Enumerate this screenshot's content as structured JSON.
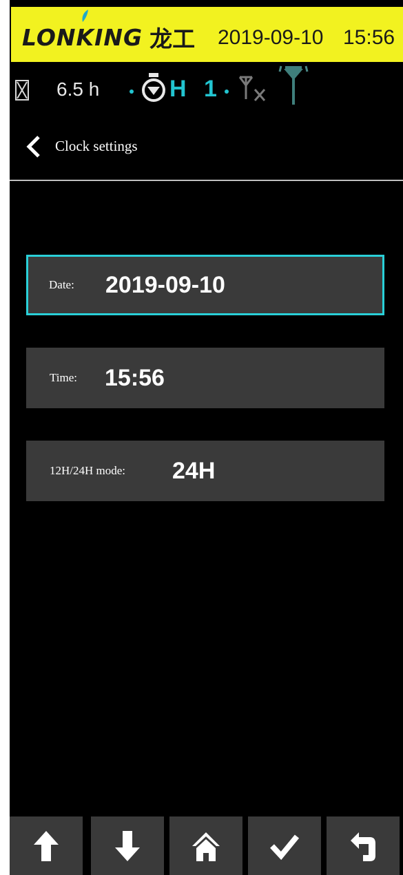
{
  "topbar": {
    "brand": "LONKING",
    "brand_cn": "龙工",
    "date": "2019-09-10",
    "time": "15:56",
    "background": "#f2f220"
  },
  "status": {
    "hours": "6.5 h",
    "gear_mode": "H",
    "gear_number": "1",
    "icons": [
      "hourglass-icon",
      "engine-icon",
      "no-signal-antenna-icon",
      "signal-tower-icon"
    ],
    "accent": "#22c4d0"
  },
  "header": {
    "back_icon": "chevron-left-icon",
    "title": "Clock settings"
  },
  "settings": [
    {
      "label": "Date:",
      "value": "2019-09-10",
      "selected": true
    },
    {
      "label": "Time:",
      "value": "15:56",
      "selected": false
    },
    {
      "label": "12H/24H mode:",
      "value": "24H",
      "selected": false
    }
  ],
  "nav_buttons": [
    {
      "name": "up",
      "icon": "arrow-up-icon"
    },
    {
      "name": "down",
      "icon": "arrow-down-icon"
    },
    {
      "name": "home",
      "icon": "home-icon"
    },
    {
      "name": "confirm",
      "icon": "check-icon"
    },
    {
      "name": "back",
      "icon": "return-icon"
    }
  ],
  "colors": {
    "background": "#000000",
    "row": "#3a3a3a",
    "selection": "#2ad0d8"
  }
}
